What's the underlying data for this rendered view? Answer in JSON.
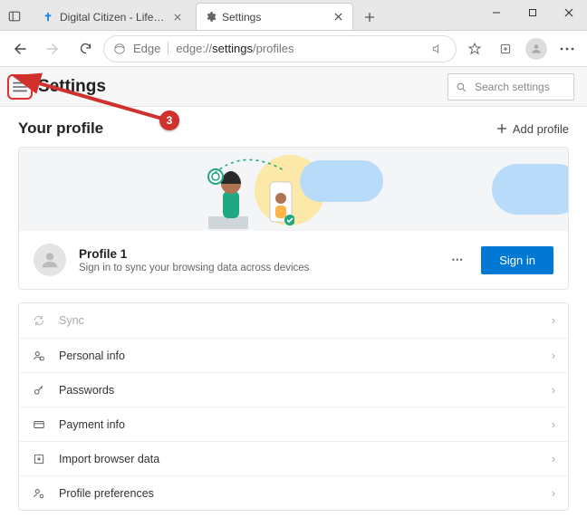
{
  "tabs": [
    {
      "title": "Digital Citizen - Life in a digital w",
      "active": false
    },
    {
      "title": "Settings",
      "active": true
    }
  ],
  "address": {
    "edge_label": "Edge",
    "url_grey_prefix": "edge://",
    "url_dark": "settings",
    "url_grey_suffix": "/profiles"
  },
  "settings": {
    "title": "Settings",
    "search_placeholder": "Search settings"
  },
  "section": {
    "title": "Your profile",
    "add_label": "Add profile"
  },
  "profile": {
    "name": "Profile 1",
    "desc": "Sign in to sync your browsing data across devices",
    "signin_label": "Sign in"
  },
  "list": [
    {
      "label": "Sync",
      "disabled": true
    },
    {
      "label": "Personal info",
      "disabled": false
    },
    {
      "label": "Passwords",
      "disabled": false
    },
    {
      "label": "Payment info",
      "disabled": false
    },
    {
      "label": "Import browser data",
      "disabled": false
    },
    {
      "label": "Profile preferences",
      "disabled": false
    }
  ],
  "annotation": {
    "number": "3"
  }
}
